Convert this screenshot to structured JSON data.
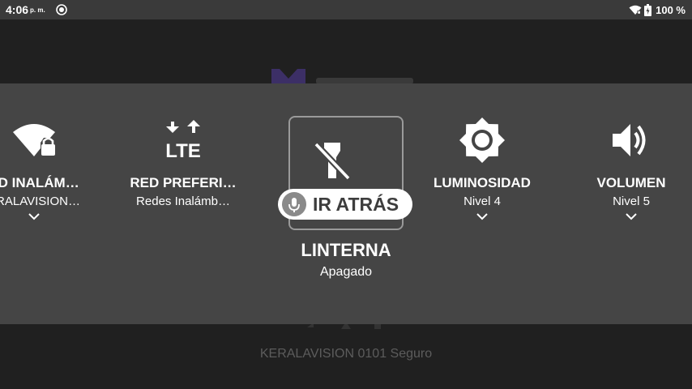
{
  "status_bar": {
    "time": "4:06",
    "ampm": "p. m.",
    "battery_percent": "100 %",
    "icons": [
      "cast-icon",
      "wifi-icon",
      "battery-icon"
    ]
  },
  "background": {
    "network_text": "KERALAVISION 0101 Seguro"
  },
  "quick_settings": {
    "wifi": {
      "label": "RED INALÁMBRICA",
      "label_visible": "ED INALÁM…",
      "sub_visible": "ERALAVISION…",
      "icon": "wifi-lock-icon"
    },
    "lte": {
      "label": "RED PREFERI…",
      "sub": "Redes Inalámb…",
      "icon": "lte-icon"
    },
    "flashlight": {
      "label": "LINTERNA",
      "sub": "Apagado",
      "icon": "flashlight-off-icon"
    },
    "brightness": {
      "label": "LUMINOSIDAD",
      "sub": "Nivel 4",
      "icon": "brightness-icon"
    },
    "volume": {
      "label": "VOLUMEN",
      "sub": "Nivel 5",
      "icon": "volume-icon"
    }
  },
  "voice_hint": {
    "label": "IR ATRÁS",
    "icon": "mic-icon"
  },
  "colors": {
    "panel": "#454545",
    "status_bar": "#3a3a3a",
    "background": "#202020",
    "focus_border": "#9a9a9a",
    "logo_accent": "#3c2f66"
  }
}
